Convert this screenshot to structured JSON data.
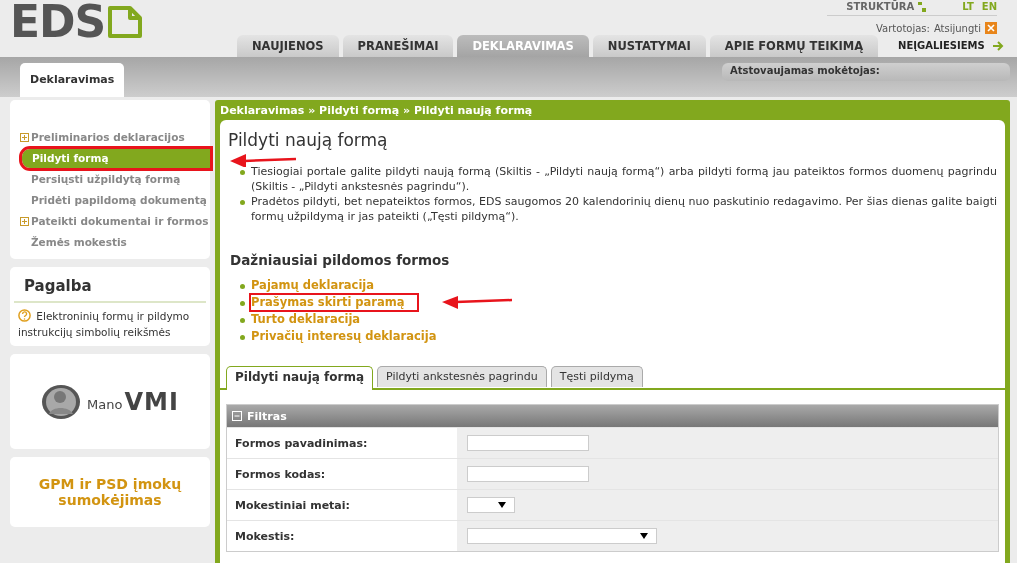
{
  "logo": "EDS",
  "top_links": {
    "structure": "STRUKTŪRA",
    "languages": [
      "LT",
      "EN"
    ],
    "user_label": "Vartotojas:",
    "logout": "Atsijungti"
  },
  "nav_tabs": [
    {
      "label": "NAUJIENOS",
      "selected": false
    },
    {
      "label": "PRANEŠIMAI",
      "selected": false
    },
    {
      "label": "DEKLARAVIMAS",
      "selected": true
    },
    {
      "label": "NUSTATYMAI",
      "selected": false
    },
    {
      "label": "APIE FORMŲ TEIKIMĄ",
      "selected": false
    }
  ],
  "accessibility_link": "NEĮGALIESIEMS",
  "section_tab": "Deklaravimas",
  "representative_label": "Atstovaujamas mokėtojas:",
  "sidebar": {
    "items": [
      {
        "label": "Preliminarios deklaracijos",
        "expandable": true,
        "selected": false,
        "annotated": false
      },
      {
        "label": "Pildyti formą",
        "expandable": false,
        "selected": true,
        "annotated": true
      },
      {
        "label": "Persiųsti užpildytą formą",
        "expandable": false,
        "selected": false,
        "annotated": false
      },
      {
        "label": "Pridėti papildomą dokumentą",
        "expandable": false,
        "selected": false,
        "annotated": false
      },
      {
        "label": "Pateikti dokumentai ir formos",
        "expandable": true,
        "selected": false,
        "annotated": false
      },
      {
        "label": "Žemės mokestis",
        "expandable": false,
        "selected": false,
        "annotated": false
      }
    ],
    "help": {
      "title": "Pagalba",
      "link": "Elektroninių formų ir pildymo instrukcijų simbolių reikšmės"
    },
    "mano_vmi": {
      "prefix": "Mano",
      "name": "VMI"
    },
    "payment_link": "GPM ir PSD įmokų sumokėjimas"
  },
  "breadcrumb": "Deklaravimas » Pildyti formą » Pildyti naują formą",
  "page_title": "Pildyti naują formą",
  "notes": [
    "Tiesiogiai portale galite pildyti naują formą (Skiltis - „Pildyti naują formą“) arba pildyti formą jau pateiktos formos duomenų pagrindu (Skiltis - „Pildyti ankstesnės pagrindu“).",
    "Pradėtos pildyti, bet nepateiktos formos, EDS saugomos 20 kalendorinių dienų nuo paskutinio redagavimo. Per šias dienas galite baigti formų užpildymą ir jas pateikti („Tęsti pildymą“)."
  ],
  "frequent_forms": {
    "title": "Dažniausiai pildomos formos",
    "items": [
      {
        "label": "Pajamų deklaracija",
        "annotated": false
      },
      {
        "label": "Prašymas skirti paramą",
        "annotated": true
      },
      {
        "label": "Turto deklaracija",
        "annotated": false
      },
      {
        "label": "Privačių interesų deklaracija",
        "annotated": false
      }
    ]
  },
  "form_tabs": [
    {
      "label": "Pildyti naują formą",
      "selected": true
    },
    {
      "label": "Pildyti ankstesnės pagrindu",
      "selected": false
    },
    {
      "label": "Tęsti pildymą",
      "selected": false
    }
  ],
  "filter": {
    "title": "Filtras",
    "expanded": true,
    "fields": [
      {
        "label": "Formos pavadinimas:",
        "kind": "text"
      },
      {
        "label": "Formos kodas:",
        "kind": "text"
      },
      {
        "label": "Mokestiniai metai:",
        "kind": "short-select"
      },
      {
        "label": "Mokestis:",
        "kind": "select"
      }
    ]
  }
}
